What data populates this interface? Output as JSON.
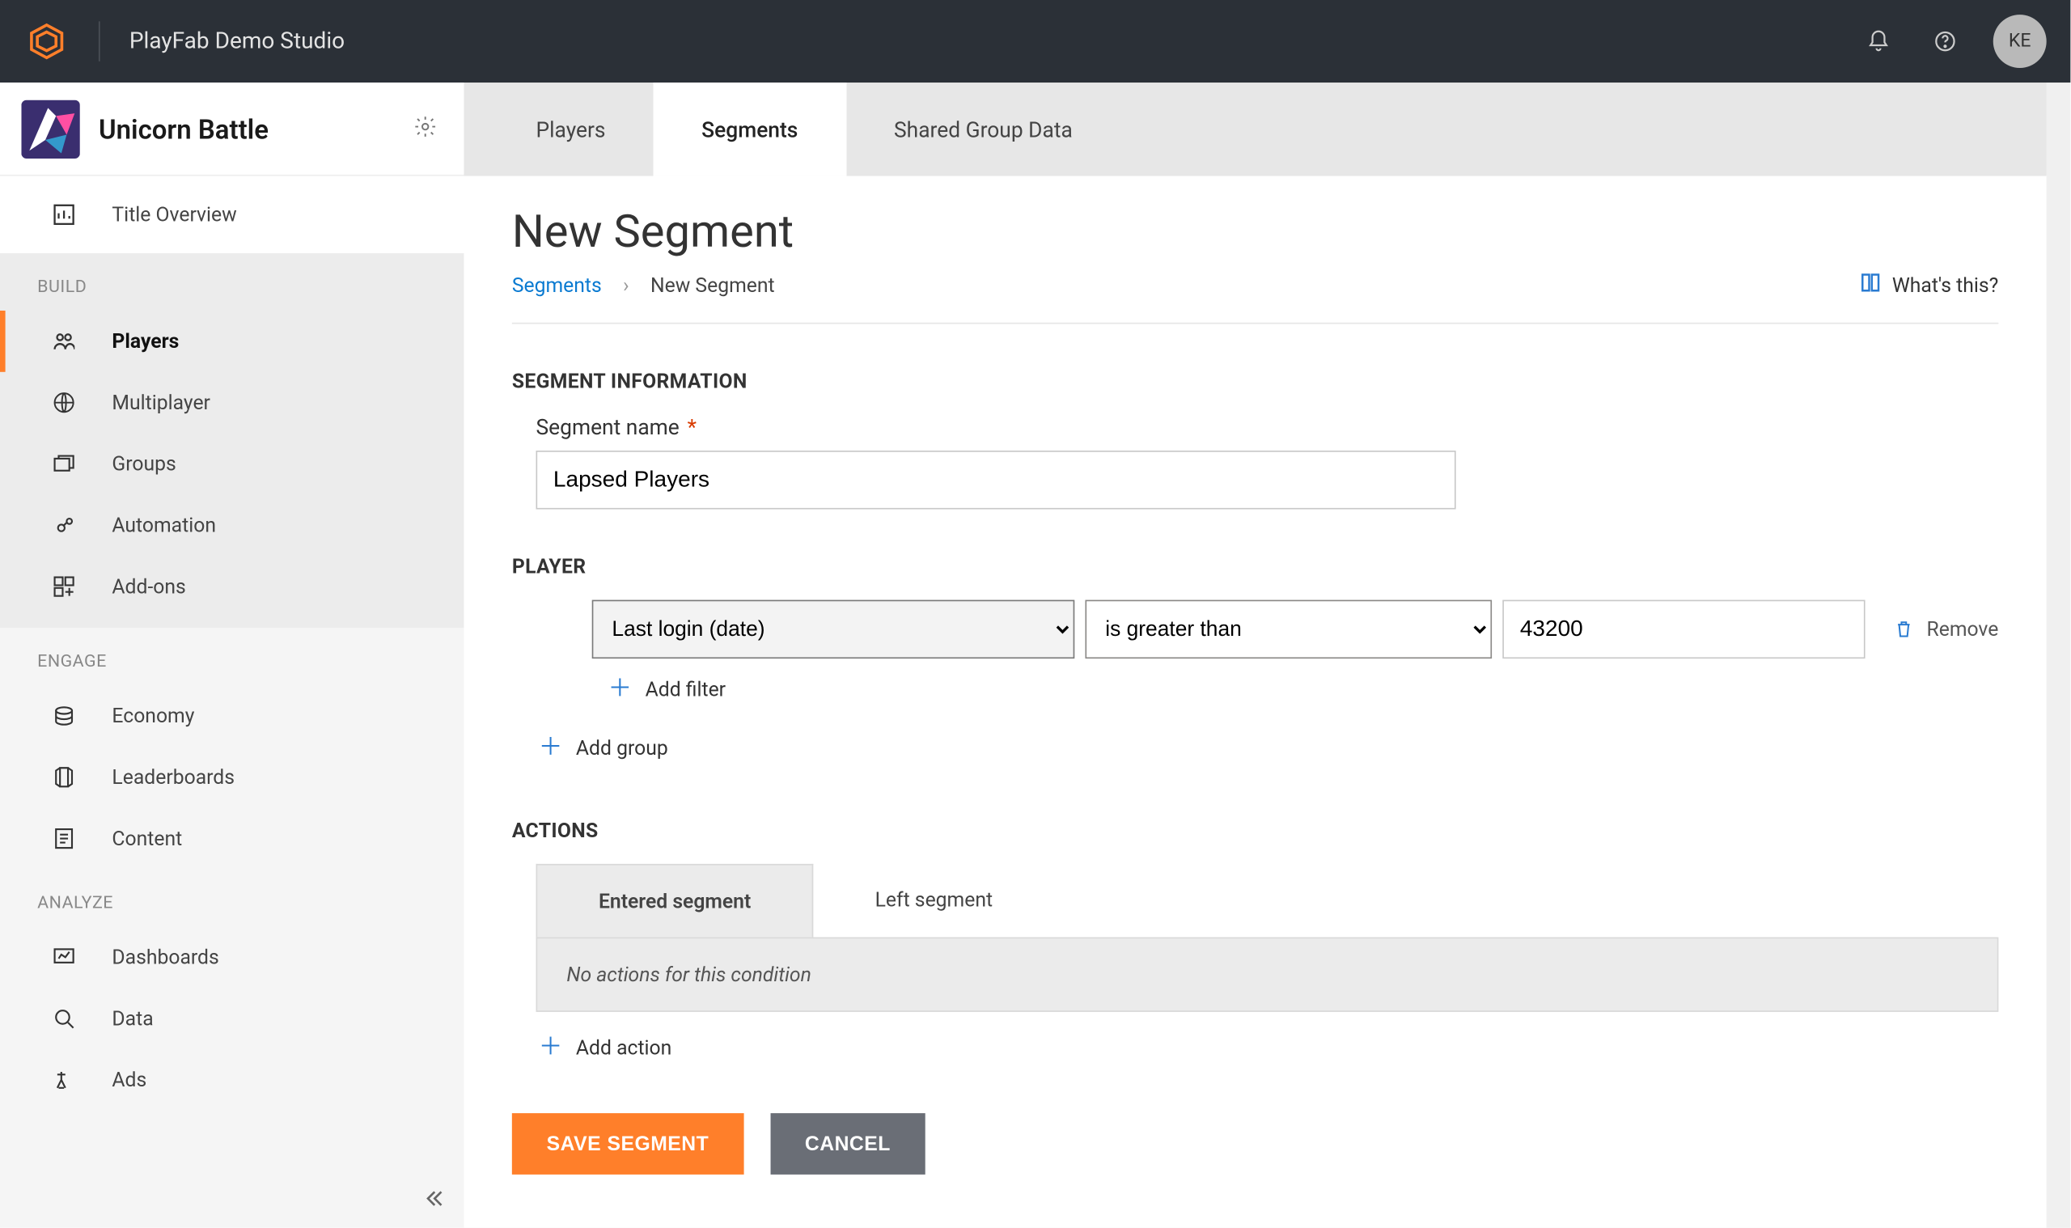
{
  "header": {
    "studio_name": "PlayFab Demo Studio",
    "avatar_initials": "KE"
  },
  "sidebar": {
    "title_name": "Unicorn Battle",
    "overview_label": "Title Overview",
    "sections": {
      "build": {
        "label": "BUILD",
        "items": [
          "Players",
          "Multiplayer",
          "Groups",
          "Automation",
          "Add-ons"
        ]
      },
      "engage": {
        "label": "ENGAGE",
        "items": [
          "Economy",
          "Leaderboards",
          "Content"
        ]
      },
      "analyze": {
        "label": "ANALYZE",
        "items": [
          "Dashboards",
          "Data",
          "Ads"
        ]
      }
    }
  },
  "tabs": {
    "players": "Players",
    "segments": "Segments",
    "shared_group": "Shared Group Data"
  },
  "page": {
    "title": "New Segment",
    "breadcrumb_root": "Segments",
    "breadcrumb_current": "New Segment",
    "whats_this": "What's this?"
  },
  "segment_info": {
    "heading": "SEGMENT INFORMATION",
    "name_label": "Segment name",
    "name_value": "Lapsed Players"
  },
  "player_filter": {
    "heading": "PLAYER",
    "field": "Last login (date)",
    "operator": "is greater than",
    "value": "43200",
    "remove_label": "Remove",
    "add_filter_label": "Add filter",
    "add_group_label": "Add group"
  },
  "actions": {
    "heading": "ACTIONS",
    "tab_entered": "Entered segment",
    "tab_left": "Left segment",
    "empty_text": "No actions for this condition",
    "add_action_label": "Add action"
  },
  "buttons": {
    "save": "SAVE SEGMENT",
    "cancel": "CANCEL"
  }
}
